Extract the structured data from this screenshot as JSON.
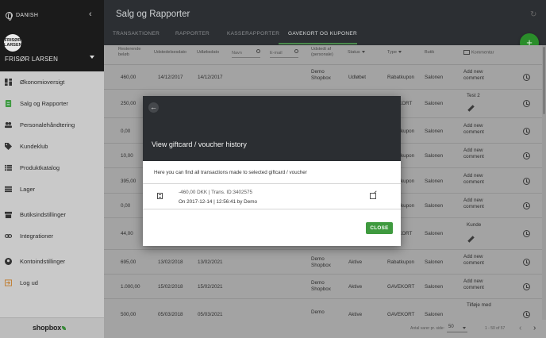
{
  "sidebar": {
    "language": "DANISH",
    "avatar_text": "FRISØR LARSEN",
    "user_name": "FRISØR LARSEN",
    "items": [
      {
        "label": "Økonomioversigt",
        "icon": "dashboard-icon"
      },
      {
        "label": "Salg og Rapporter",
        "icon": "receipt-icon",
        "active": true
      },
      {
        "label": "Personalehåndtering",
        "icon": "people-icon"
      },
      {
        "label": "Kundeklub",
        "icon": "tag-icon"
      },
      {
        "label": "Produktkatalog",
        "icon": "list-icon"
      },
      {
        "label": "Lager",
        "icon": "inventory-icon"
      },
      {
        "label": "Butiksindstillinger",
        "icon": "store-icon"
      },
      {
        "label": "Integrationer",
        "icon": "link-icon"
      },
      {
        "label": "Kontoindstillinger",
        "icon": "account-icon"
      },
      {
        "label": "Log ud",
        "icon": "logout-icon"
      }
    ],
    "logo_text": "shopbox"
  },
  "header": {
    "title": "Salg og Rapporter",
    "tabs": [
      "TRANSAKTIONER",
      "RAPPORTER",
      "KASSERAPPORTER",
      "GAVEKORT OG KUPONER"
    ],
    "fab": "+"
  },
  "table": {
    "headers": {
      "remaining": "Resterende beløb",
      "issued": "Udstedelsesdato",
      "expiry": "Udløbsdato",
      "name_placeholder": "Navn",
      "email_placeholder": "E-mail",
      "issued_by": "Udstedt af (personale)",
      "status": "Status",
      "type": "Type",
      "shop": "Butik",
      "comment": "Kommentar"
    },
    "rows": [
      {
        "remaining": "460,00",
        "issued": "14/12/2017",
        "expiry": "14/12/2017",
        "issued_by": "Demo Shopbox",
        "status": "Udløbet",
        "type": "Rabatkupon",
        "shop": "Salonen",
        "comment": "Add new comment"
      },
      {
        "remaining": "250,00",
        "issued": "",
        "expiry": "",
        "issued_by": "",
        "status": "",
        "type": "KORT",
        "shop": "Salonen",
        "comment": "Test 2"
      },
      {
        "remaining": "0,00",
        "issued": "",
        "expiry": "",
        "issued_by": "",
        "status": "",
        "type": "kupon",
        "shop": "Salonen",
        "comment": "Add new comment"
      },
      {
        "remaining": "10,00",
        "issued": "",
        "expiry": "",
        "issued_by": "",
        "status": "",
        "type": "kupon",
        "shop": "Salonen",
        "comment": "Add new comment"
      },
      {
        "remaining": "395,00",
        "issued": "",
        "expiry": "",
        "issued_by": "",
        "status": "",
        "type": "kupon",
        "shop": "Salonen",
        "comment": "Add new comment"
      },
      {
        "remaining": "0,00",
        "issued": "",
        "expiry": "",
        "issued_by": "",
        "status": "",
        "type": "kupon",
        "shop": "Salonen",
        "comment": "Add new comment"
      },
      {
        "remaining": "44,00",
        "issued": "",
        "expiry": "",
        "issued_by": "",
        "status": "",
        "type": "KORT",
        "shop": "Salonen",
        "comment": "Kunde"
      },
      {
        "remaining": "695,00",
        "issued": "13/02/2018",
        "expiry": "13/02/2021",
        "issued_by": "Demo Shopbox",
        "status": "Aktive",
        "type": "Rabatkupon",
        "shop": "Salonen",
        "comment": "Add new comment"
      },
      {
        "remaining": "1.000,00",
        "issued": "15/02/2018",
        "expiry": "15/02/2021",
        "issued_by": "Demo Shopbox",
        "status": "Aktive",
        "type": "GAVEKORT",
        "shop": "Salonen",
        "comment": "Add new comment"
      },
      {
        "remaining": "500,00",
        "issued": "05/03/2018",
        "expiry": "05/03/2021",
        "issued_by": "Demo",
        "status": "Aktive",
        "type": "GAVEKORT",
        "shop": "Salonen",
        "comment": "Tilføje med"
      }
    ]
  },
  "footer": {
    "per_page_label": "Antal varer pr. side:",
    "per_page_value": "50",
    "range": "1 - 50 of 57",
    "prev": "‹",
    "next": "›"
  },
  "modal": {
    "title": "View giftcard / voucher history",
    "description": "Here you can find all transactions made to selected giftcard / voucher",
    "transaction": {
      "line1": "-460,00 DKK | Trans. ID:3402575",
      "line2": "On 2017-12-14 | 12:56:41 by Demo"
    },
    "close_label": "CLOSE",
    "back": "←"
  }
}
